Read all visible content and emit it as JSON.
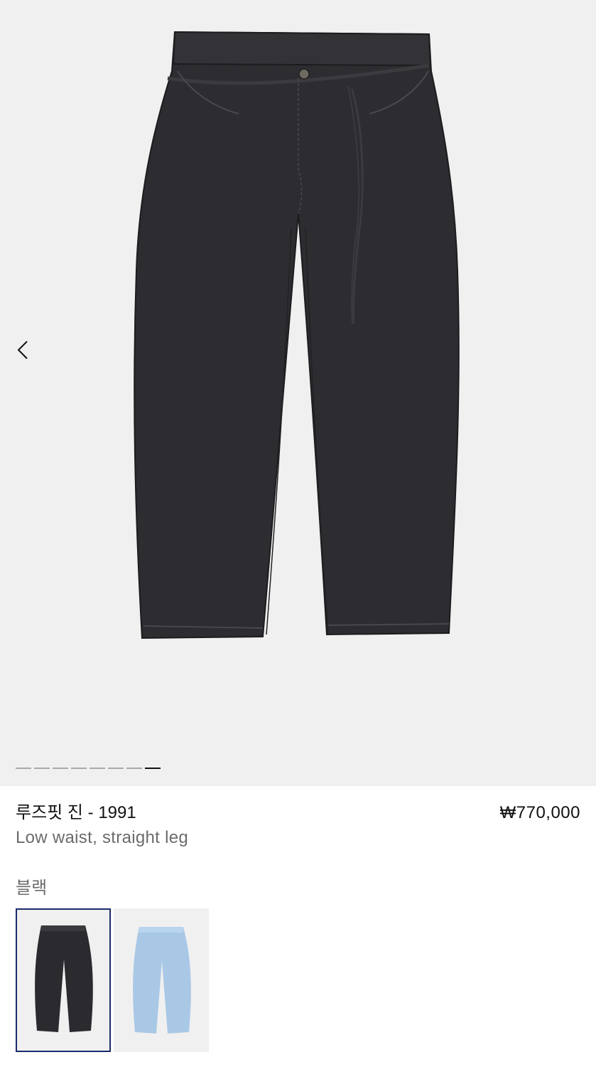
{
  "product": {
    "title": "루즈핏 진 - 1991",
    "price": "₩770,000",
    "subtitle": "Low waist, straight leg",
    "color_label": "블랙"
  },
  "gallery": {
    "image_count": 8,
    "active_index": 7,
    "prev_icon": "chevron-left-icon"
  },
  "swatches": [
    {
      "name": "black",
      "color": "#2b2a2e",
      "selected": true
    },
    {
      "name": "light-blue",
      "color": "#a9c8e6",
      "selected": false
    }
  ],
  "colors": {
    "gallery_bg": "#f0f0f0",
    "denim_black": "#2b2a2e",
    "denim_blue": "#a9c8e6",
    "selected_border": "#1b2a6b"
  }
}
